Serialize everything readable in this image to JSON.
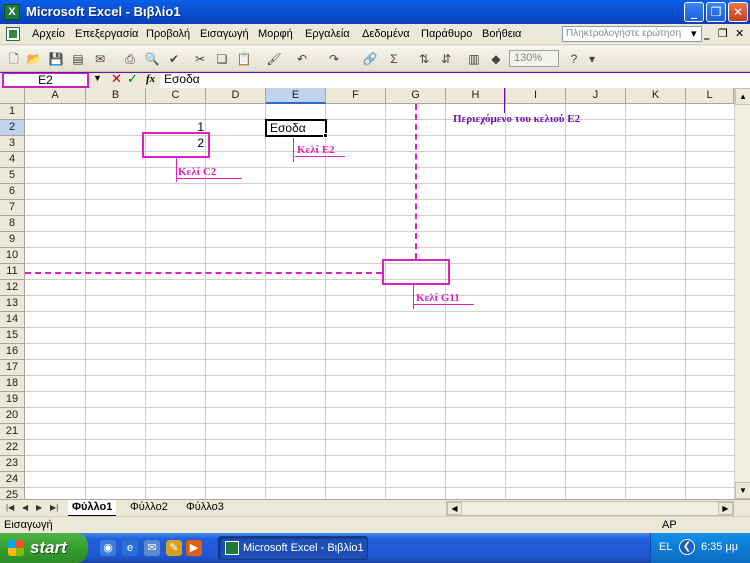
{
  "window": {
    "title": "Microsoft Excel - Βιβλίο1"
  },
  "menu": {
    "items": [
      "Αρχείο",
      "Επεξεργασία",
      "Προβολή",
      "Εισαγωγή",
      "Μορφή",
      "Εργαλεία",
      "Δεδομένα",
      "Παράθυρο",
      "Βοήθεια"
    ],
    "help_placeholder": "Πληκτρολογήστε ερώτηση"
  },
  "toolbar": {
    "zoom": "130%"
  },
  "formula_bar": {
    "name_box": "E2",
    "fx": "fx",
    "content": "Εσοδα"
  },
  "sheet": {
    "columns": [
      "A",
      "B",
      "C",
      "D",
      "E",
      "F",
      "G",
      "H",
      "I",
      "J",
      "K",
      "L"
    ],
    "rows": [
      "1",
      "2",
      "3",
      "4",
      "5",
      "6",
      "7",
      "8",
      "9",
      "10",
      "11",
      "12",
      "13",
      "14",
      "15",
      "16",
      "17",
      "18",
      "19",
      "20",
      "21",
      "22",
      "23",
      "24",
      "25"
    ],
    "cells": {
      "C2": "1",
      "C3": "2",
      "E2": "Εσοδα"
    }
  },
  "annotations": {
    "cell_c2": "Κελί C2",
    "cell_e2": "Κελί E2",
    "cell_g11": "Κελί G11",
    "content_e2": "Περιεχόμενο του κελιού E2"
  },
  "tabs": [
    "Φύλλο1",
    "Φύλλο2",
    "Φύλλο3"
  ],
  "status": {
    "mode": "Εισαγωγή",
    "indicator": "ΑΡ"
  },
  "taskbar": {
    "start": "start",
    "task": "Microsoft Excel - Βιβλίο1",
    "lang": "EL",
    "time": "6:35 μμ"
  }
}
